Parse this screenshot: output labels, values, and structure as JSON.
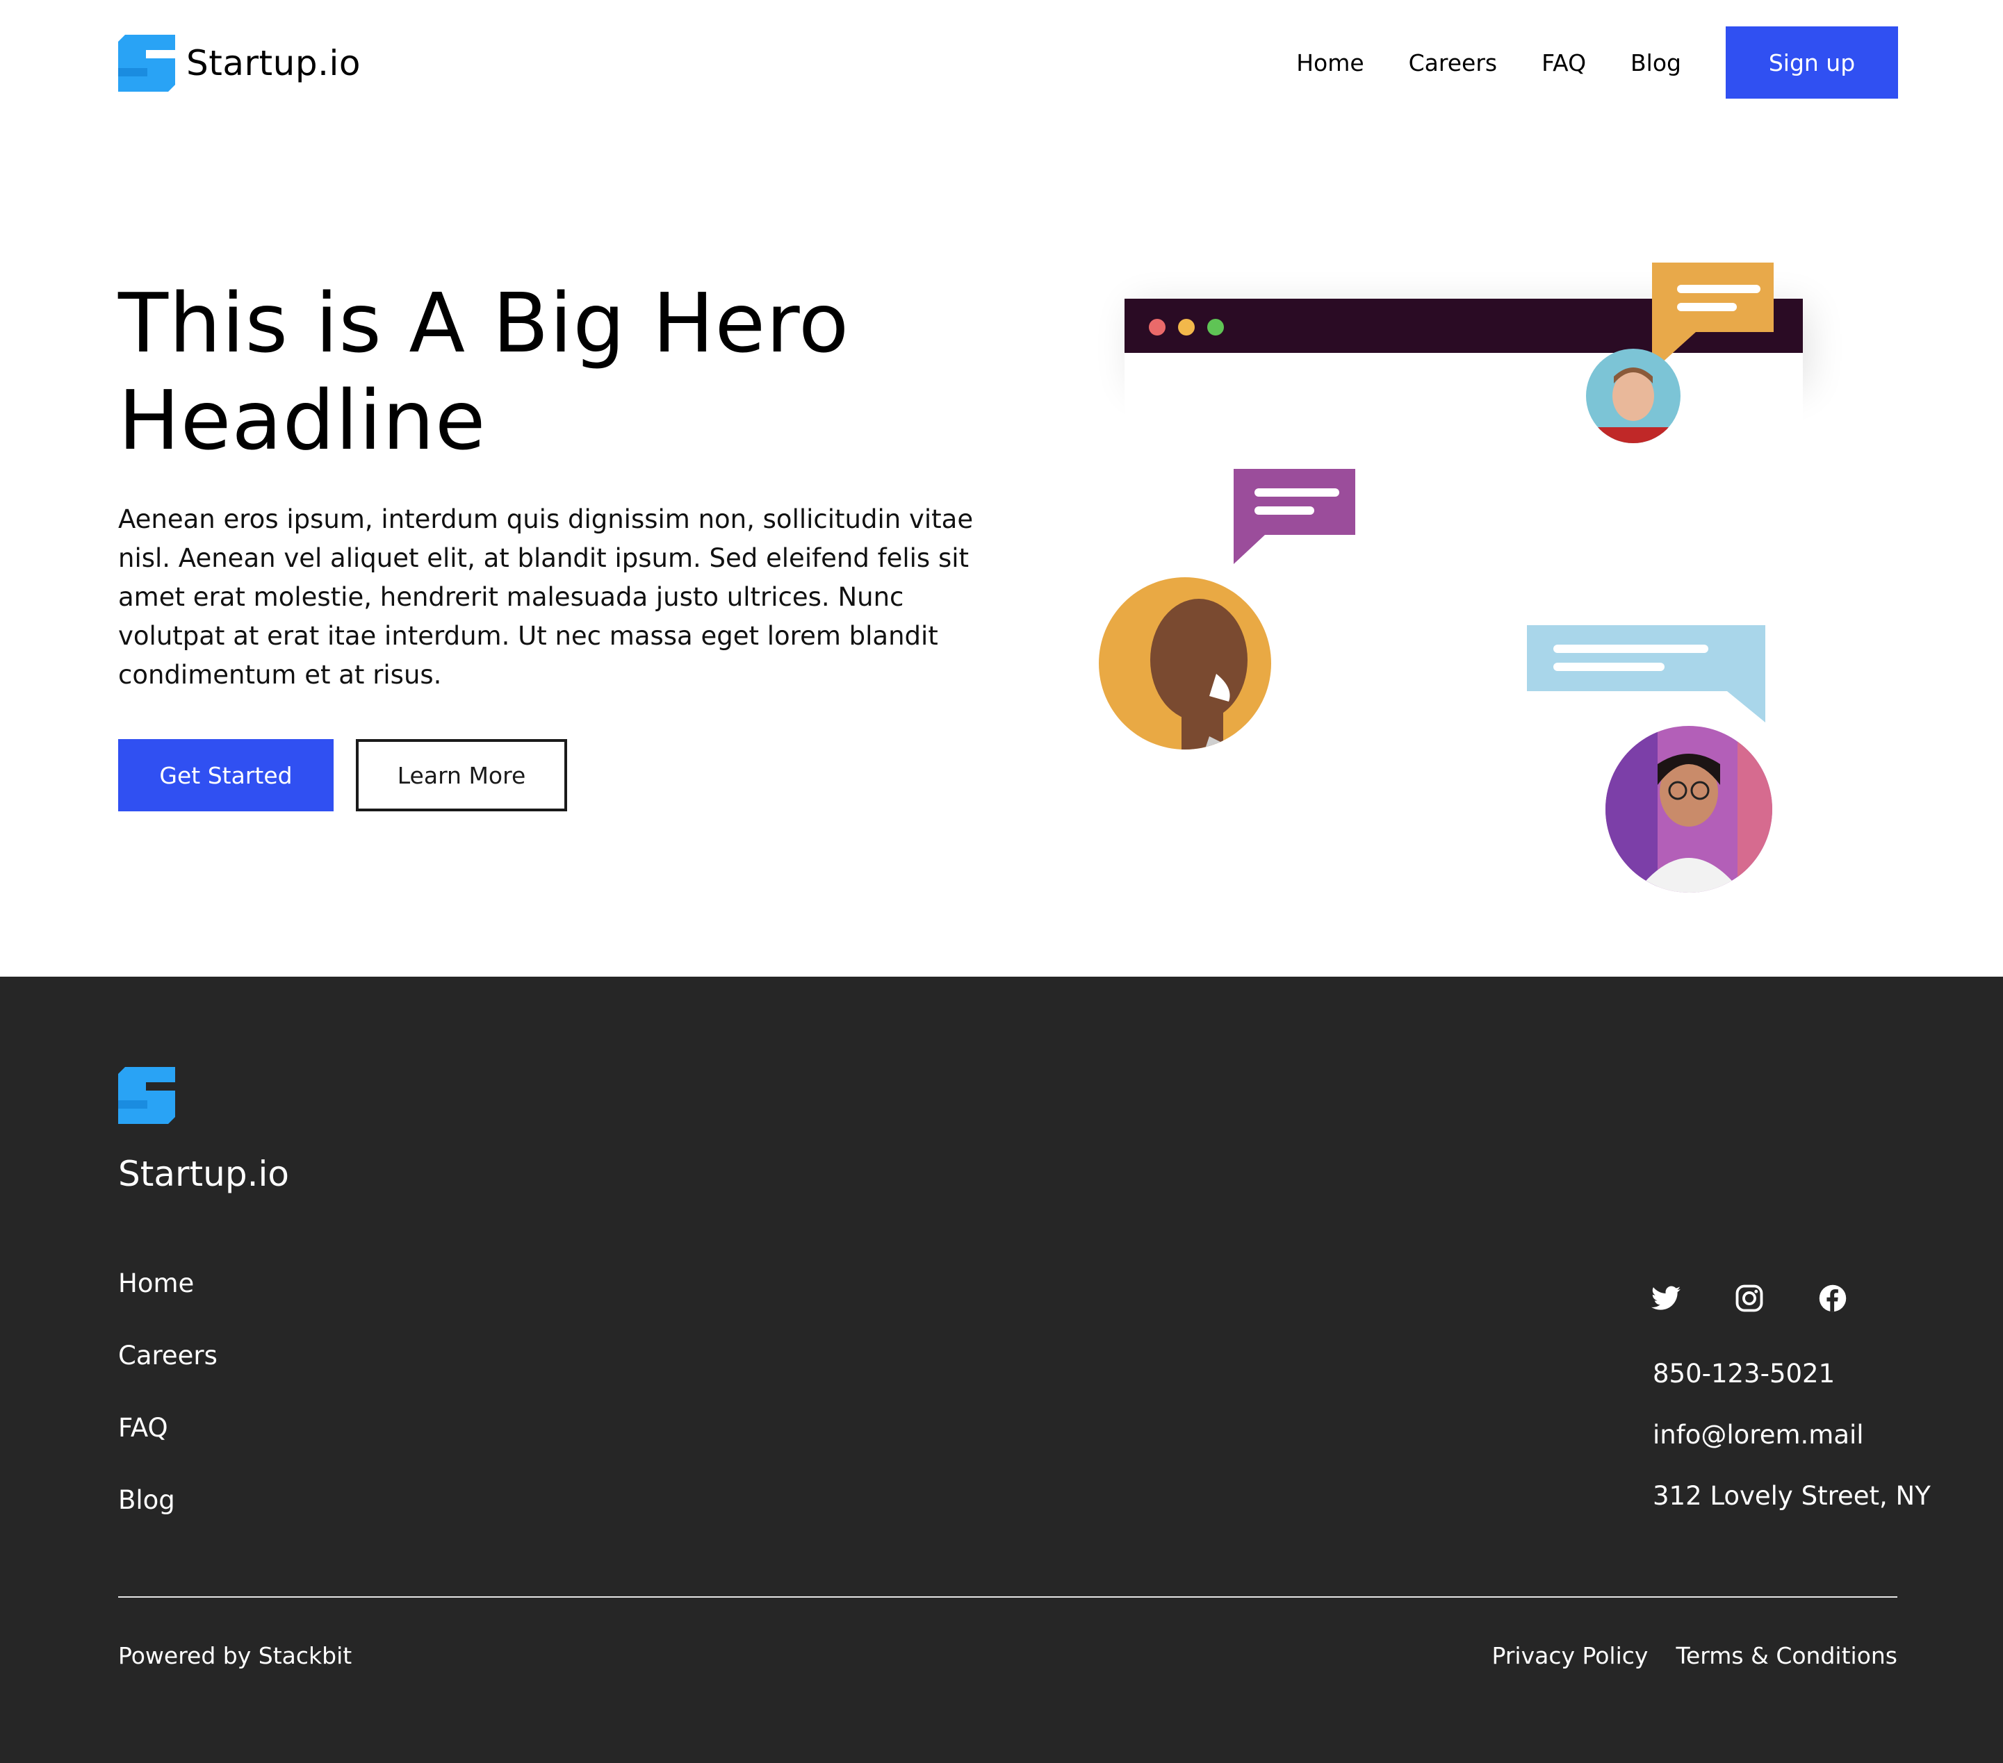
{
  "brand": {
    "name": "Startup.io",
    "accent": "#29a3f5",
    "primary": "#3050f2"
  },
  "nav": {
    "items": [
      {
        "label": "Home"
      },
      {
        "label": "Careers"
      },
      {
        "label": "FAQ"
      },
      {
        "label": "Blog"
      }
    ],
    "signup_label": "Sign up"
  },
  "hero": {
    "title": "This is A Big Hero Headline",
    "text": "Aenean eros ipsum, interdum quis dignissim non, sollicitudin vitae nisl. Aenean vel aliquet elit, at blandit ipsum. Sed eleifend felis sit amet erat molestie, hendrerit malesuada justo ultrices. Nunc volutpat at erat itae interdum. Ut nec massa eget lorem blandit condimentum et at risus.",
    "primary_button": "Get Started",
    "secondary_button": "Learn More"
  },
  "footer": {
    "brand_name": "Startup.io",
    "nav": [
      {
        "label": "Home"
      },
      {
        "label": "Careers"
      },
      {
        "label": "FAQ"
      },
      {
        "label": "Blog"
      }
    ],
    "social": [
      "twitter-icon",
      "instagram-icon",
      "facebook-icon"
    ],
    "contact": {
      "phone": "850-123-5021",
      "email": "info@lorem.mail",
      "address": "312 Lovely Street, NY"
    },
    "powered": "Powered by Stackbit",
    "legal": [
      {
        "label": "Privacy Policy"
      },
      {
        "label": "Terms & Conditions"
      }
    ],
    "background": "#262626"
  }
}
